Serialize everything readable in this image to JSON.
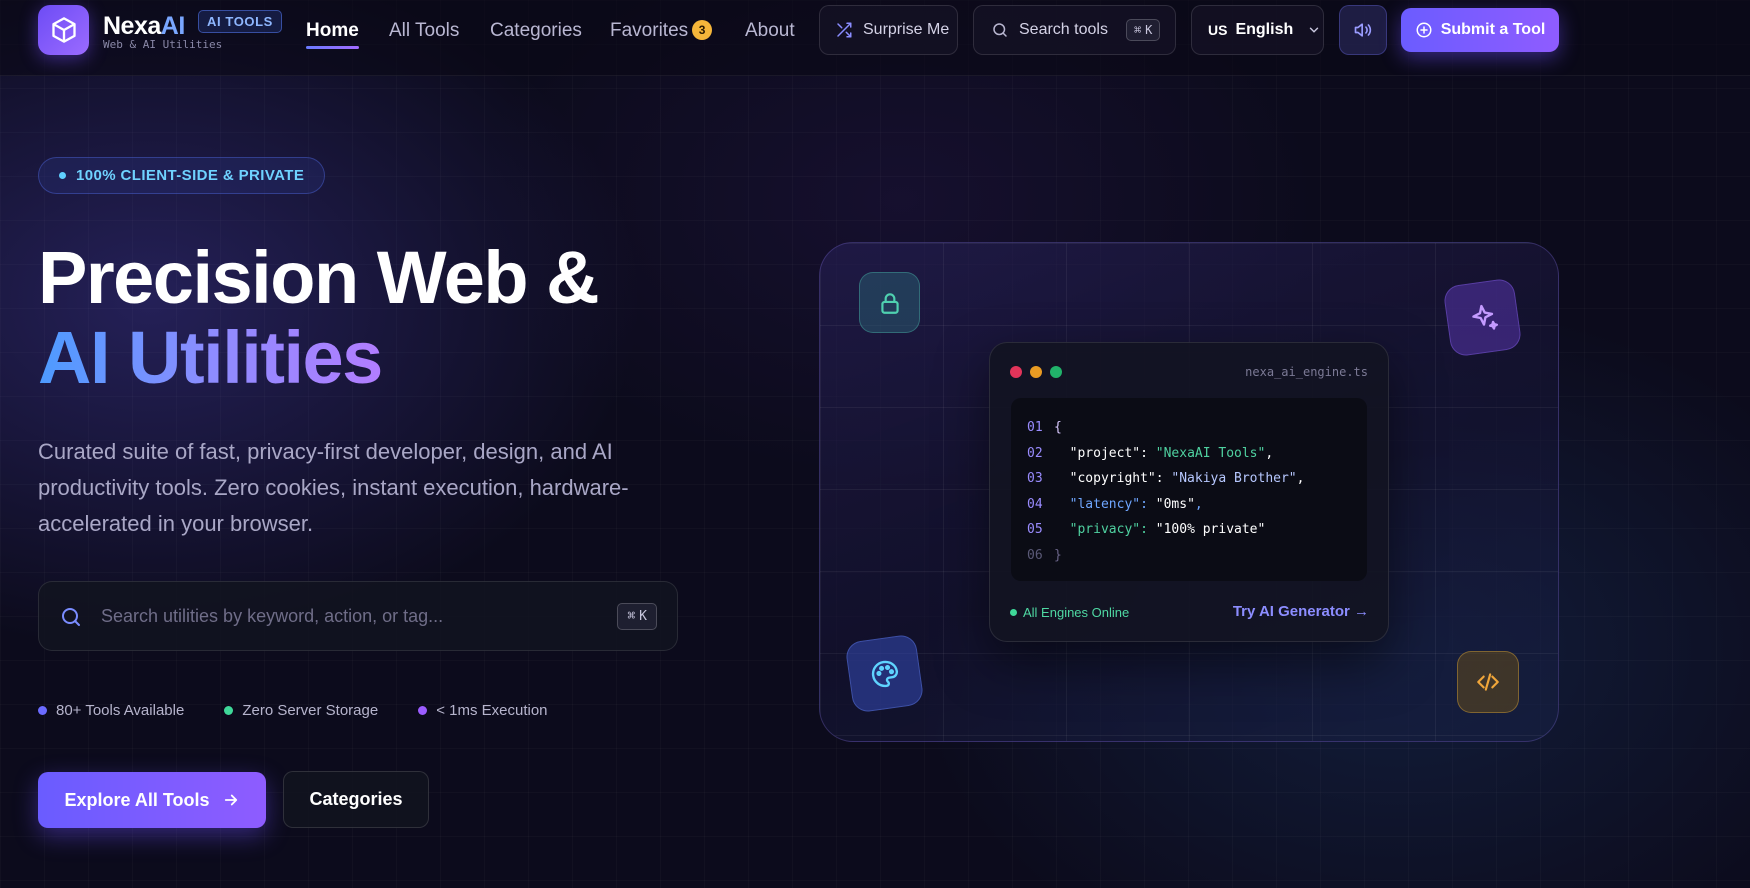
{
  "nav": {
    "brand_main": "Nexa",
    "brand_ai": "AI",
    "brand_tag": "AI TOOLS",
    "brand_sub": "Web & AI Utilities",
    "links": [
      {
        "label": "Home",
        "active": true
      },
      {
        "label": "All Tools"
      },
      {
        "label": "Categories"
      },
      {
        "label": "Favorites",
        "badge": "3"
      },
      {
        "label": "About"
      }
    ],
    "surprise_label": "Surprise Me",
    "search_label": "Search tools",
    "search_kbd": "K",
    "lang_code": "US",
    "lang_label": "English",
    "submit_label": "Submit a Tool"
  },
  "hero": {
    "pill": "100% CLIENT-SIDE & PRIVATE",
    "title_line1": "Precision Web &",
    "title_line2": "AI Utilities",
    "description": "Curated suite of fast, privacy-first developer, design, and AI productivity tools. Zero cookies, instant execution, hardware-accelerated in your browser.",
    "search_placeholder": "Search utilities by keyword, action, or tag...",
    "search_kbd": "K",
    "stats": [
      {
        "label": "80+ Tools Available",
        "color": "#6b6bff"
      },
      {
        "label": "Zero Server Storage",
        "color": "#3fd899"
      },
      {
        "label": "< 1ms Execution",
        "color": "#9b5cff"
      }
    ],
    "primary_cta": "Explore All Tools",
    "secondary_cta": "Categories"
  },
  "code_card": {
    "file_name": "nexa_ai_engine.ts",
    "lines": [
      {
        "n": "01",
        "text": "{"
      },
      {
        "n": "02",
        "key": "\"project\"",
        "val": "\"NexaAI Tools\""
      },
      {
        "n": "03",
        "key": "\"copyright\"",
        "val": "\"Nakiya Brother\""
      },
      {
        "n": "04",
        "key": "\"latency\"",
        "val": "\"0ms\""
      },
      {
        "n": "05",
        "key": "\"privacy\"",
        "val": "\"100% private\""
      },
      {
        "n": "06",
        "text": "}"
      }
    ],
    "status": "All Engines Online",
    "link": "Try AI Generator →"
  },
  "colors": {
    "accent": "#6b5cff",
    "accent2": "#8f5cff",
    "online": "#3fd899"
  },
  "icons": {
    "logo": "cube-icon",
    "float_1": "lock-icon",
    "float_2": "sparkle-icon",
    "float_3": "palette-icon",
    "float_4": "code-icon"
  }
}
